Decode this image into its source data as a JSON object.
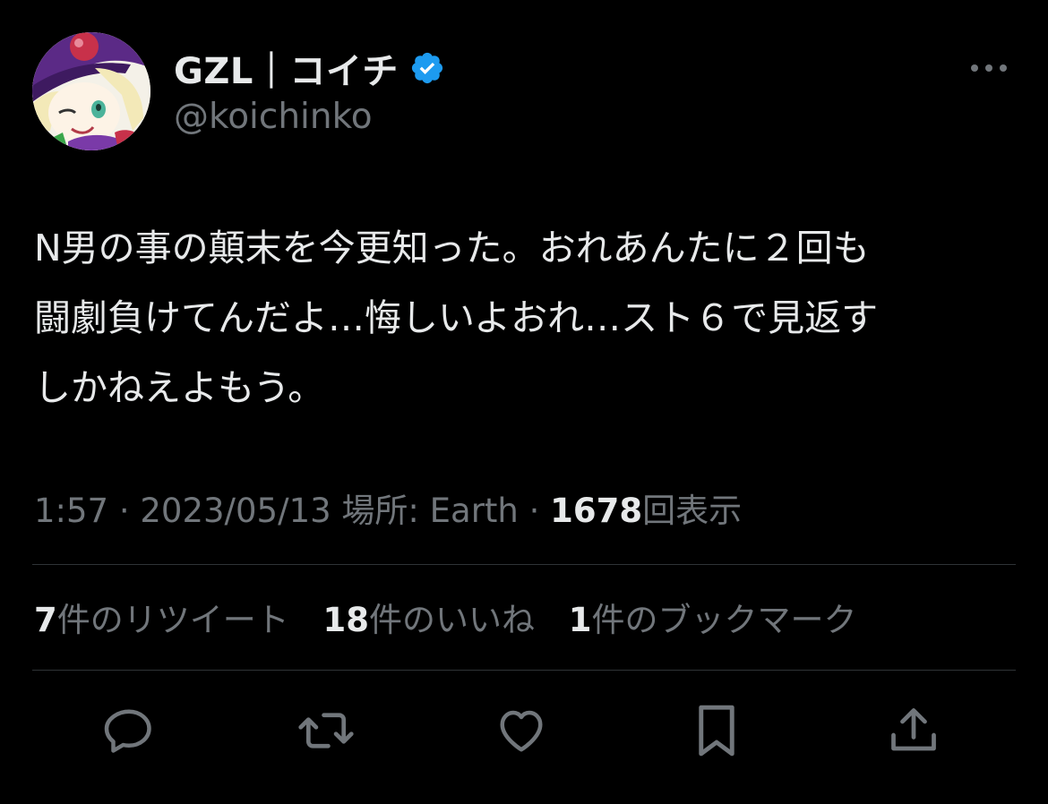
{
  "tweet": {
    "display_name": "GZL｜コイチ",
    "handle": "@koichinko",
    "verified": true,
    "text_lines": [
      "N男の事の顛末を今更知った。おれあんたに２回も",
      "闘劇負けてんだよ…悔しいよおれ…スト６で見返す",
      "しかねえよもう。"
    ],
    "time": "1:57",
    "separator": "·",
    "date": "2023/05/13",
    "location": "場所: Earth",
    "views_count": "1678",
    "views_label": "回表示",
    "retweets_count": "7",
    "retweets_label": "件のリツイート",
    "likes_count": "18",
    "likes_label": "件のいいね",
    "bookmarks_count": "1",
    "bookmarks_label": "件のブックマーク"
  },
  "icons": {
    "verified": "verified-badge-icon",
    "more": "more-horizontal-icon",
    "reply": "reply-icon",
    "retweet": "retweet-icon",
    "like": "heart-icon",
    "bookmark": "bookmark-icon",
    "share": "share-icon"
  },
  "colors": {
    "background": "#000000",
    "primary_text": "#e7e9ea",
    "secondary_text": "#71767b",
    "divider": "#2f3336",
    "verified_blue": "#1d9bf0"
  }
}
